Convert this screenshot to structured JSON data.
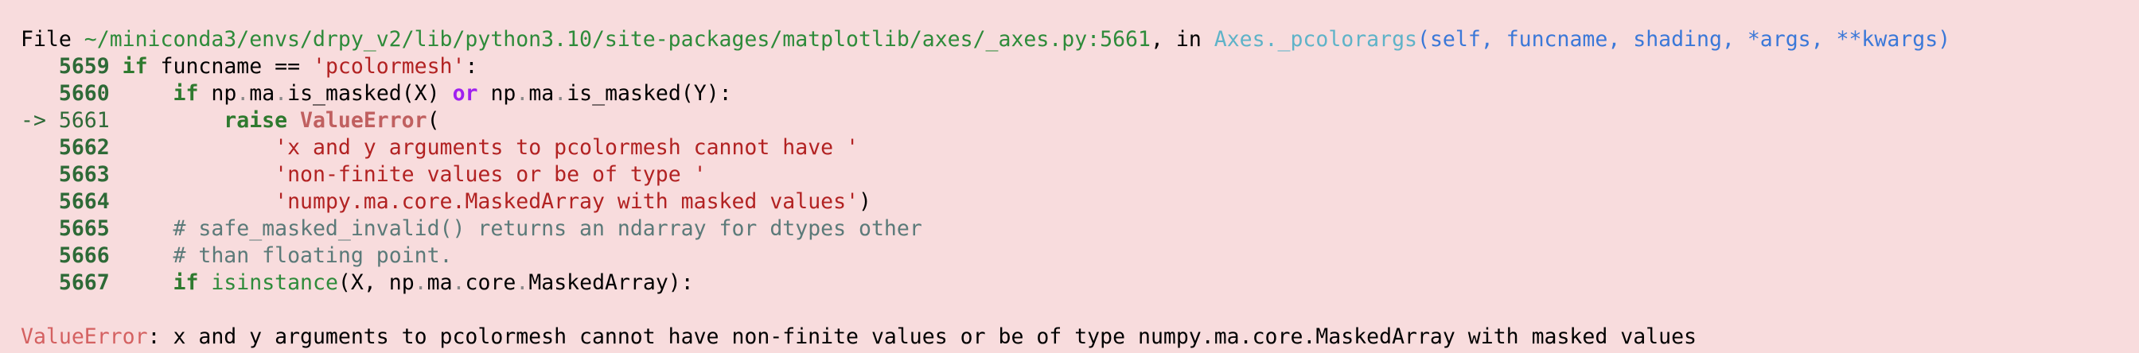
{
  "traceback": {
    "file_prefix": "File ",
    "file_path": "~/miniconda3/envs/drpy_v2/lib/python3.10/site-packages/matplotlib/axes/_axes.py:5661",
    "in_text": ", in ",
    "func_name": "Axes._pcolorargs",
    "func_args": "(self, funcname, shading, *args, **kwargs)",
    "lines": [
      {
        "lineno": "5659",
        "prefix": "   "
      },
      {
        "lineno": "5660",
        "prefix": "   "
      },
      {
        "lineno": "5661",
        "prefix": "-> "
      },
      {
        "lineno": "5662",
        "prefix": "   "
      },
      {
        "lineno": "5663",
        "prefix": "   "
      },
      {
        "lineno": "5664",
        "prefix": "   "
      },
      {
        "lineno": "5665",
        "prefix": "   "
      },
      {
        "lineno": "5666",
        "prefix": "   "
      },
      {
        "lineno": "5667",
        "prefix": "   "
      }
    ],
    "code": {
      "l5659_if": "if",
      "l5659_rest": " funcname == ",
      "l5659_str": "'pcolormesh'",
      "l5659_end": ":",
      "l5660_if": "if",
      "l5660_a": " np",
      "l5660_b": "ma",
      "l5660_c": "is_masked(X) ",
      "l5660_or": "or",
      "l5660_d": " np",
      "l5660_e": "ma",
      "l5660_f": "is_masked(Y):",
      "l5661_raise": "raise",
      "l5661_exc": "ValueError",
      "l5661_paren": "(",
      "l5662_str": "'x and y arguments to pcolormesh cannot have '",
      "l5663_str": "'non-finite values or be of type '",
      "l5664_str": "'numpy.ma.core.MaskedArray with masked values'",
      "l5664_paren": ")",
      "l5665_cmt": "# safe_masked_invalid() returns an ndarray for dtypes other",
      "l5666_cmt": "# than floating point.",
      "l5667_if": "if",
      "l5667_isinstance": "isinstance",
      "l5667_a": "(X, np",
      "l5667_b": "ma",
      "l5667_c": "core",
      "l5667_d": "MaskedArray):"
    },
    "error_type": "ValueError",
    "error_message": ": x and y arguments to pcolormesh cannot have non-finite values or be of type numpy.ma.core.MaskedArray with masked values"
  },
  "colors": {
    "background": "#f8dcdd",
    "lineno": "#2e6a37",
    "keyword": "#2f7a2f",
    "string": "#b22222",
    "comment": "#5b7a79",
    "exception": "#d46161",
    "path": "#2e8b3a",
    "func_name": "#5fb3c8",
    "func_args": "#3b78d8"
  }
}
